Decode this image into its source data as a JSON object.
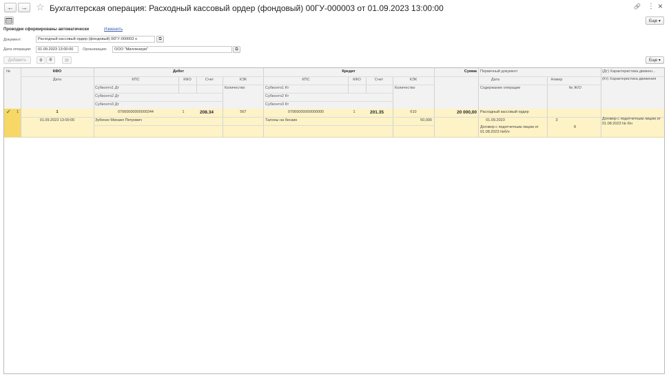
{
  "window": {
    "title": "Бухгалтерская операция: Расходный кассовый ордер (фондовый) 00ГУ-000003 от 01.09.2023 13:00:00",
    "back_icon": "←",
    "forward_icon": "→",
    "star_icon": "☆",
    "link_icon": "🔗",
    "menu_icon": "⋮",
    "close_icon": "×"
  },
  "toolbar": {
    "more_label": "Еще ▾"
  },
  "info": {
    "auto_text": "Проводки сформированы автоматически",
    "change_link": "Изменить"
  },
  "form": {
    "document_label": "Документ:",
    "document_value": "Расходный кассовый ордер (фондовый) 00ГУ-000003 о",
    "date_label": "Дата операции:",
    "date_value": "01.09.2023 13:00:00",
    "org_label": "Организация:",
    "org_value": "ООО \"Миллениум\""
  },
  "table_toolbar": {
    "add_label": "Добавить",
    "more_label": "Еще ▾"
  },
  "table": {
    "headers": {
      "num": "№",
      "kfo": "КФО",
      "date": "Дата",
      "debit": "Дебет",
      "credit": "Кредит",
      "kps": "КПС",
      "kfo_col": "КФО",
      "account": "Счет",
      "kek": "КЭК",
      "quantity": "Количество",
      "sub1_dt": "Субконто1 Дт",
      "sub2_dt": "Субконто2 Дт",
      "sub3_dt": "Субконто3 Дт",
      "sub1_kt": "Субконто1 Кт",
      "sub2_kt": "Субконто2 Кт",
      "sub3_kt": "Субконто3 Кт",
      "sum": "Сумма",
      "primary_doc": "Первичный документ",
      "pd_date": "Дата",
      "pd_number": "Номер",
      "content": "Содержание операции",
      "journal": "№ Ж/О",
      "dt_char": "(Дт) Характеристика движен...",
      "kt_char": "(Кт) Характеристика движения"
    },
    "row": {
      "check_icon": "✓",
      "num": "1",
      "kfo": "1",
      "date": "01.09.2023 13:00:00",
      "dt_kps": "07060000000000244",
      "dt_kfo": "1",
      "dt_account": "208.34",
      "dt_kek": "567",
      "dt_sub1": "Зубенко Михаил Петрович",
      "kt_kps": "07060000000000000",
      "kt_kfo": "1",
      "kt_account": "201.35",
      "kt_kek": "610",
      "kt_sub1": "Талоны на бензин",
      "kt_quantity": "50,000",
      "sum": "20 000,00",
      "pd_name": "Расходный кассовый ордер",
      "pd_date": "01.09.2023",
      "pd_number": "3",
      "content": "Договор с подотчетным лицом от 01.08.2023 №б/н",
      "journal": "8",
      "kt_char": "Договор с подотчетным лицом от 01.08.2023 № б/н"
    }
  }
}
